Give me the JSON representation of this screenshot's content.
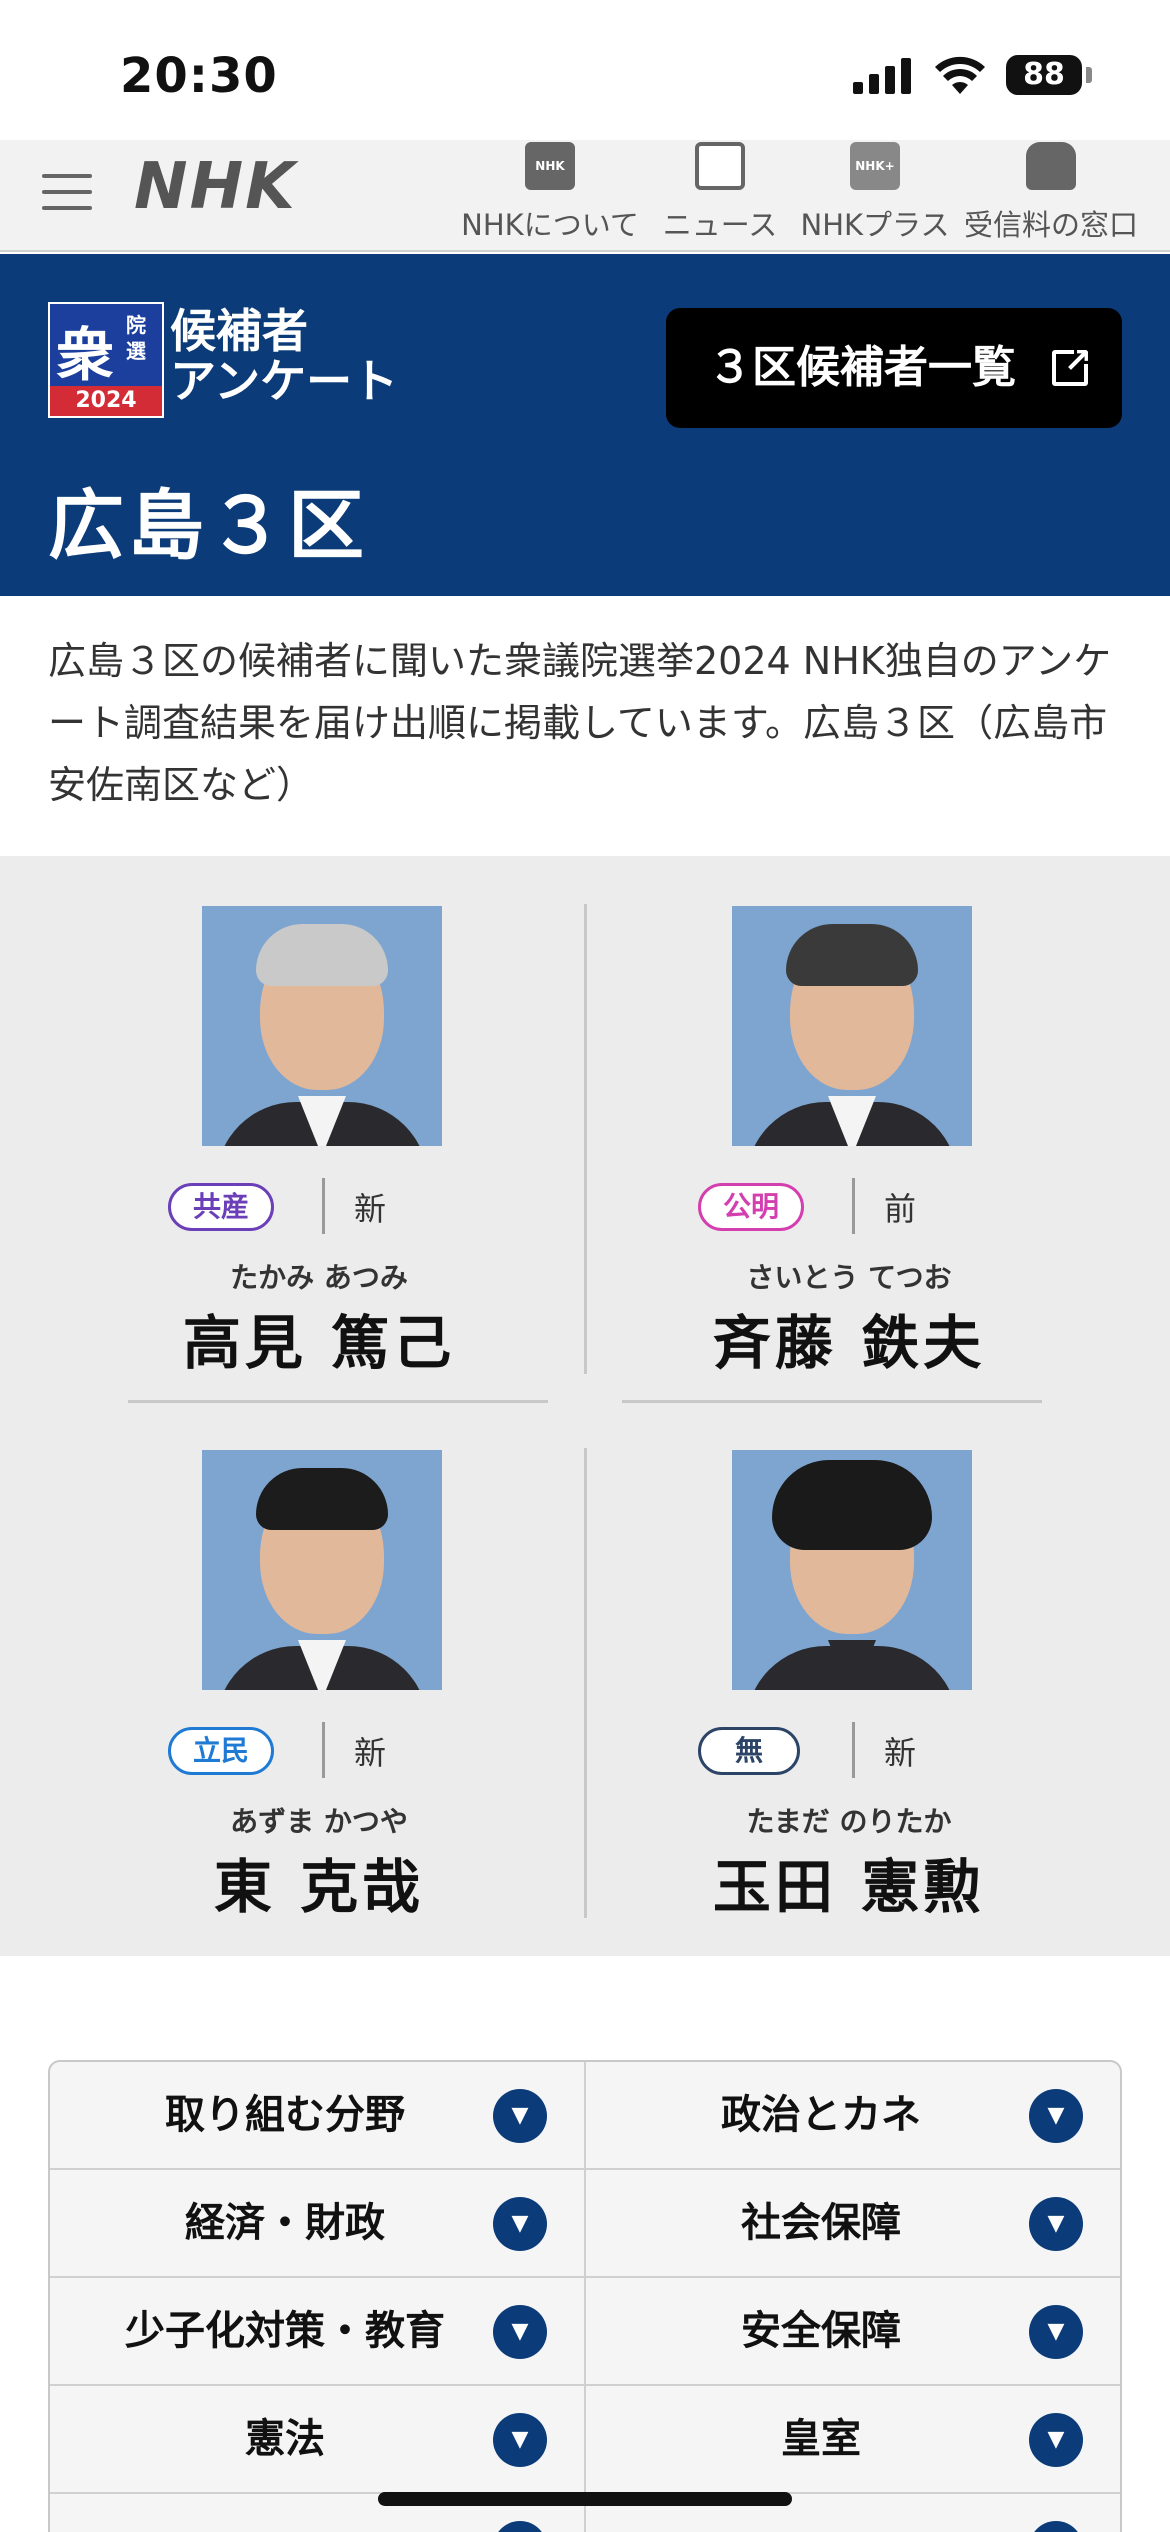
{
  "status_bar": {
    "time": "20:30",
    "battery": "88"
  },
  "nav": {
    "logo": "NHK",
    "items": [
      {
        "label": "NHKについて",
        "icon": "nhk-icon"
      },
      {
        "label": "ニュース",
        "icon": "news-icon"
      },
      {
        "label": "NHKプラス",
        "icon": "nhk-plus-icon"
      },
      {
        "label": "受信料の窓口",
        "icon": "domo-icon"
      }
    ]
  },
  "hero": {
    "badge_main": "衆",
    "badge_small": "院選",
    "badge_year": "2024",
    "survey_line1": "候補者",
    "survey_line2": "アンケート",
    "list_button": "３区候補者一覧",
    "district": "広島３区"
  },
  "description": "広島３区の候補者に聞いた衆議院選挙2024 NHK独自のアンケート調査結果を届け出順に掲載しています。広島３区（広島市安佐南区など）",
  "candidates": [
    {
      "party": "共産",
      "status": "新",
      "kana": "たかみ あつみ",
      "name": "高見 篤己",
      "party_color": "#6a3fb8"
    },
    {
      "party": "公明",
      "status": "前",
      "kana": "さいとう てつお",
      "name": "斉藤 鉄夫",
      "party_color": "#d43fb0"
    },
    {
      "party": "立民",
      "status": "新",
      "kana": "あずま かつや",
      "name": "東 克哉",
      "party_color": "#1f7ad4"
    },
    {
      "party": "無",
      "status": "新",
      "kana": "たまだ のりたか",
      "name": "玉田 憲勲",
      "party_color": "#2c4466"
    }
  ],
  "topics": [
    {
      "label": "取り組む分野"
    },
    {
      "label": "政治とカネ"
    },
    {
      "label": "経済・財政"
    },
    {
      "label": "社会保障"
    },
    {
      "label": "少子化対策・教育"
    },
    {
      "label": "安全保障"
    },
    {
      "label": "憲法"
    },
    {
      "label": "皇室"
    }
  ]
}
